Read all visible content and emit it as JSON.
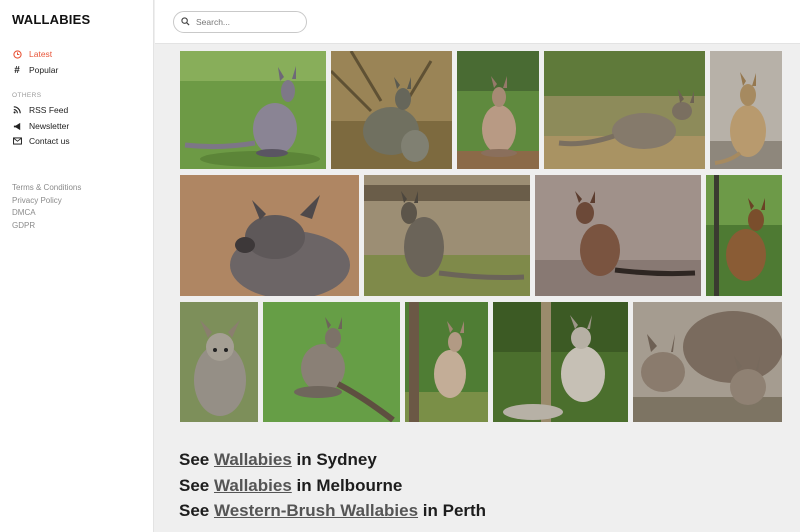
{
  "brand": "WALLABIES",
  "nav": {
    "latest": "Latest",
    "popular": "Popular",
    "others_label": "OTHERS",
    "rss": "RSS Feed",
    "newsletter": "Newsletter",
    "contact": "Contact us"
  },
  "footer_links": {
    "terms": "Terms & Conditions",
    "privacy": "Privacy Policy",
    "dmca": "DMCA",
    "gdpr": "GDPR"
  },
  "search": {
    "placeholder": "Search..."
  },
  "see_links": [
    {
      "prefix": "See",
      "link": "Wallabies",
      "suffix": "in Sydney"
    },
    {
      "prefix": "See",
      "link": "Wallabies",
      "suffix": "in Melbourne"
    },
    {
      "prefix": "See",
      "link": "Western-Brush Wallabies",
      "suffix": "in Perth"
    }
  ],
  "colors": {
    "accent": "#e8563a",
    "link": "#555555"
  },
  "icons": {
    "latest": "clock-icon",
    "popular": "hashtag-icon",
    "rss": "rss-icon",
    "newsletter": "megaphone-icon",
    "contact": "envelope-icon",
    "search": "search-icon"
  }
}
